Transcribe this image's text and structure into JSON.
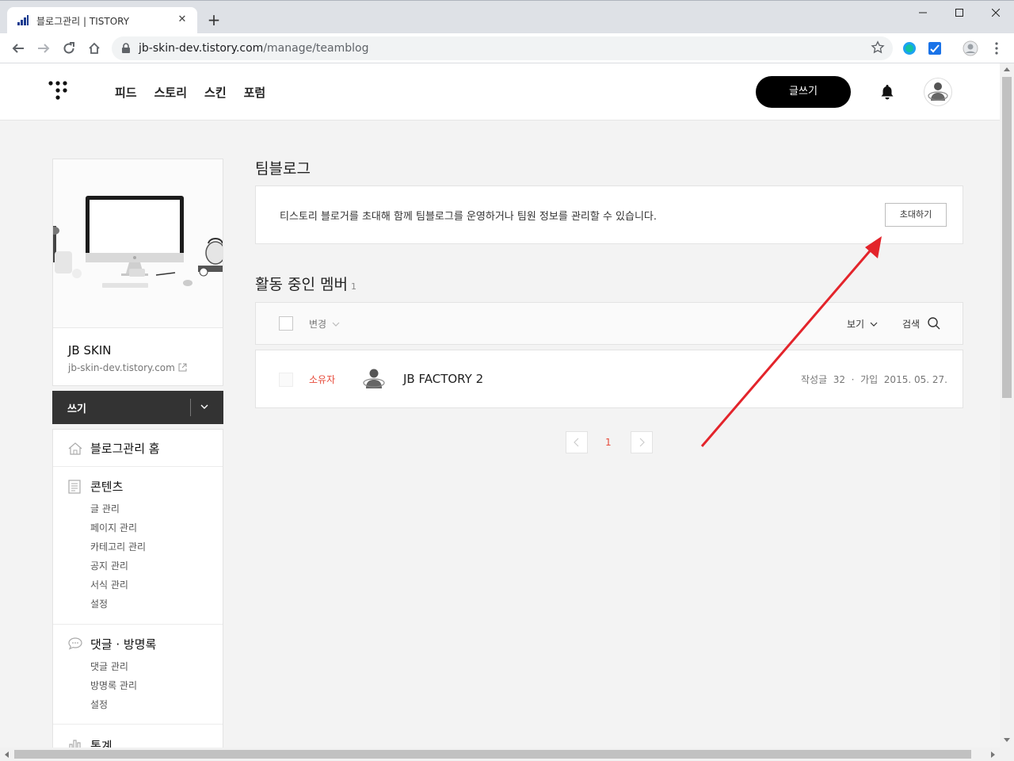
{
  "browser": {
    "tab_title": "블로그관리 | TISTORY",
    "url_host": "jb-skin-dev.tistory.com",
    "url_path": "/manage/teamblog"
  },
  "gnb": {
    "menu": [
      "피드",
      "스토리",
      "스킨",
      "포럼"
    ],
    "write_label": "글쓰기"
  },
  "sidebar": {
    "blog_name": "JB SKIN",
    "blog_url": "jb-skin-dev.tistory.com",
    "write_label": "쓰기",
    "home_label": "블로그관리 홈",
    "contents": {
      "title": "콘텐츠",
      "items": [
        "글 관리",
        "페이지 관리",
        "카테고리 관리",
        "공지 관리",
        "서식 관리",
        "설정"
      ]
    },
    "comments": {
      "title": "댓글 · 방명록",
      "items": [
        "댓글 관리",
        "방명록 관리",
        "설정"
      ]
    },
    "stats_title": "통계"
  },
  "main": {
    "title": "팀블로그",
    "invite_text": "티스토리 블로거를 초대해 함께 팀블로그를 운영하거나 팀원 정보를 관리할 수 있습니다.",
    "invite_button": "초대하기",
    "members_title": "활동 중인 멤버",
    "members_count": "1",
    "header": {
      "change_label": "변경",
      "view_label": "보기",
      "search_label": "검색"
    },
    "members": [
      {
        "role": "소유자",
        "name": "JB FACTORY 2",
        "meta": "작성글  32  ·  가입  2015. 05. 27."
      }
    ],
    "pagination": {
      "current": "1"
    }
  },
  "colors": {
    "accent_red": "#e74c3c",
    "dark": "#333333",
    "annotation_arrow": "#e3242b"
  }
}
